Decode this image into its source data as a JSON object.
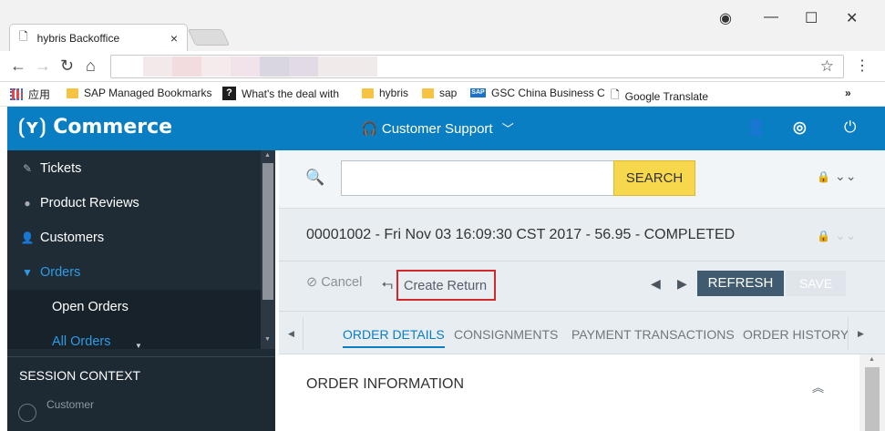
{
  "browser": {
    "tab_title": "hybris Backoffice",
    "tab_close": "×",
    "window_controls": {
      "minimize": "—",
      "maximize": "☐",
      "close": "✕"
    },
    "bookmarks": [
      {
        "label": "应用",
        "icon": "apps-icon"
      },
      {
        "label": "SAP Managed Bookmarks",
        "icon": "folder-icon"
      },
      {
        "label": "What's the deal with",
        "icon": "question-icon"
      },
      {
        "label": "hybris",
        "icon": "folder-icon"
      },
      {
        "label": "sap",
        "icon": "folder-icon"
      },
      {
        "label": "GSC China Business C",
        "icon": "sap-icon"
      },
      {
        "label": "Google Translate",
        "icon": "page-icon"
      }
    ],
    "bookmarks_overflow": "»"
  },
  "header": {
    "logo": "⟮ʏ⟯ Commerce",
    "perspective": "Customer Support"
  },
  "sidebar": {
    "items": [
      {
        "label": "Tickets"
      },
      {
        "label": "Product Reviews"
      },
      {
        "label": "Customers"
      },
      {
        "label": "Orders"
      },
      {
        "label": "Open Orders"
      },
      {
        "label": "All Orders"
      }
    ],
    "session_title": "SESSION CONTEXT",
    "session_sub": "Customer"
  },
  "search": {
    "button": "SEARCH",
    "placeholder": ""
  },
  "order": {
    "title": "00001002 - Fri Nov 03 16:09:30 CST 2017 - 56.95 - COMPLETED",
    "cancel": "Cancel",
    "create_return": "Create Return",
    "refresh": "REFRESH",
    "save": "SAVE"
  },
  "tabs": [
    {
      "label": "ORDER DETAILS"
    },
    {
      "label": "CONSIGNMENTS"
    },
    {
      "label": "PAYMENT TRANSACTIONS"
    },
    {
      "label": "ORDER HISTORY"
    }
  ],
  "section": {
    "title": "ORDER INFORMATION"
  },
  "colors": {
    "brand": "#0a7ec2",
    "sidebar": "#1f2c35",
    "search_button": "#f7d84c",
    "highlight": "#d0292b"
  }
}
